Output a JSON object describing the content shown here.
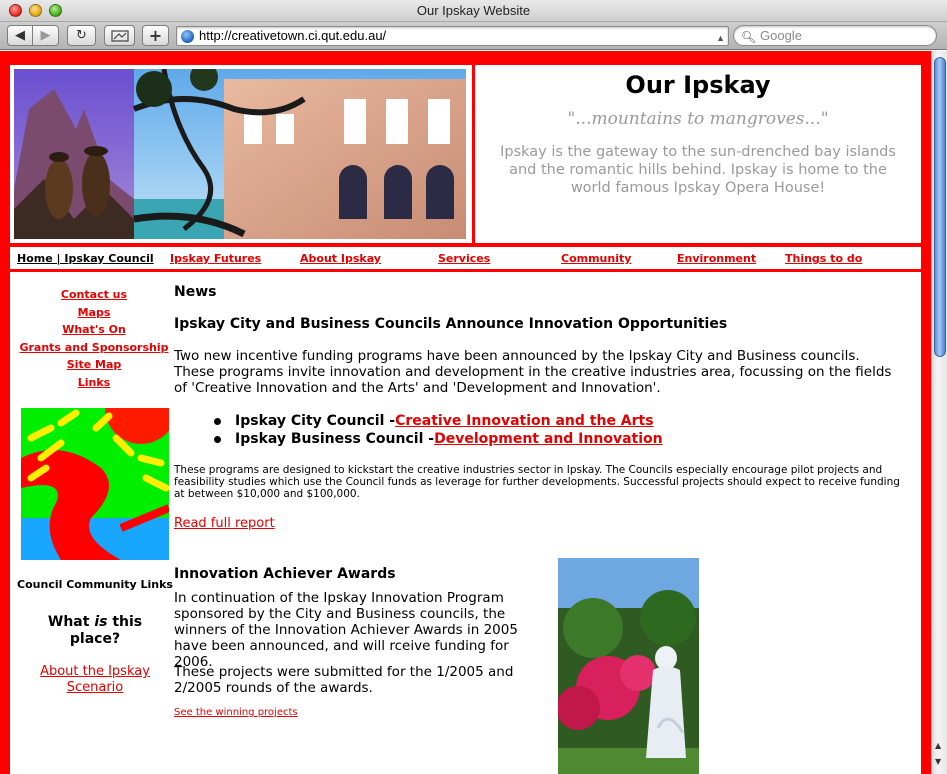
{
  "browser": {
    "window_title": "Our Ipskay Website",
    "url": "http://creativetown.ci.qut.edu.au/",
    "search_placeholder": "Google",
    "back_icon": "back-arrow-icon",
    "forward_icon": "forward-arrow-icon",
    "reload_icon": "reload-icon",
    "add_icon": "plus-icon"
  },
  "header": {
    "title": "Our Ipskay",
    "tagline": "\"...mountains to mangroves...\"",
    "intro": "Ipskay is the gateway to the sun-drenched bay islands and the romantic hills behind. Ipskay is home to the world famous Ipskay Opera House!"
  },
  "nav": {
    "items": [
      "Home | Ipskay Council",
      "Ipskay Futures",
      "About Ipskay",
      "Services",
      "Community",
      "Environment",
      "Things to do"
    ]
  },
  "sidebar": {
    "links": [
      "Contact us",
      "Maps",
      "What's On",
      "Grants and Sponsorship",
      "Site Map",
      "Links"
    ],
    "community_label": "Council Community Links",
    "what_heading_pre": "What ",
    "what_heading_em": "is",
    "what_heading_post": " this place?",
    "scenario_link": "About the Ipskay Scenario"
  },
  "news": {
    "heading": "News",
    "article_title": "Ipskay City and Business Councils Announce Innovation Opportunities",
    "article_body": "Two new incentive funding programs have been announced by the Ipskay City and Business councils. These programs invite innovation and development in the creative industries area, focussing on the fields of 'Creative Innovation and the Arts' and 'Development and Innovation'.",
    "bullets": [
      {
        "label": "Ipskay City Council - ",
        "link": "Creative Innovation and the Arts"
      },
      {
        "label": "Ipskay Business Council - ",
        "link": "Development and Innovation"
      }
    ],
    "small_print": "These programs are designed to kickstart the creative industries sector in Ipskay. The Councils especially encourage pilot projects and feasibility studies which use the Council funds as leverage for further developments. Successful projects should expect to receive funding at between $10,000 and $100,000.",
    "read_more": "Read full report",
    "awards_title": "Innovation Achiever Awards",
    "awards_body": "In continuation of the Ipskay Innovation Program sponsored by the City and Business councils, the winners of the Innovation Achiever Awards in 2005 have been announced, and will rceive funding for 2006.",
    "awards_body2": "These projects were submitted for the 1/2005 and 2/2005 rounds of the awards.",
    "winners_link": "See the winning projects"
  },
  "colors": {
    "page_background": "#ff0000",
    "link": "#e60000",
    "muted_text": "#9a9a9a"
  }
}
